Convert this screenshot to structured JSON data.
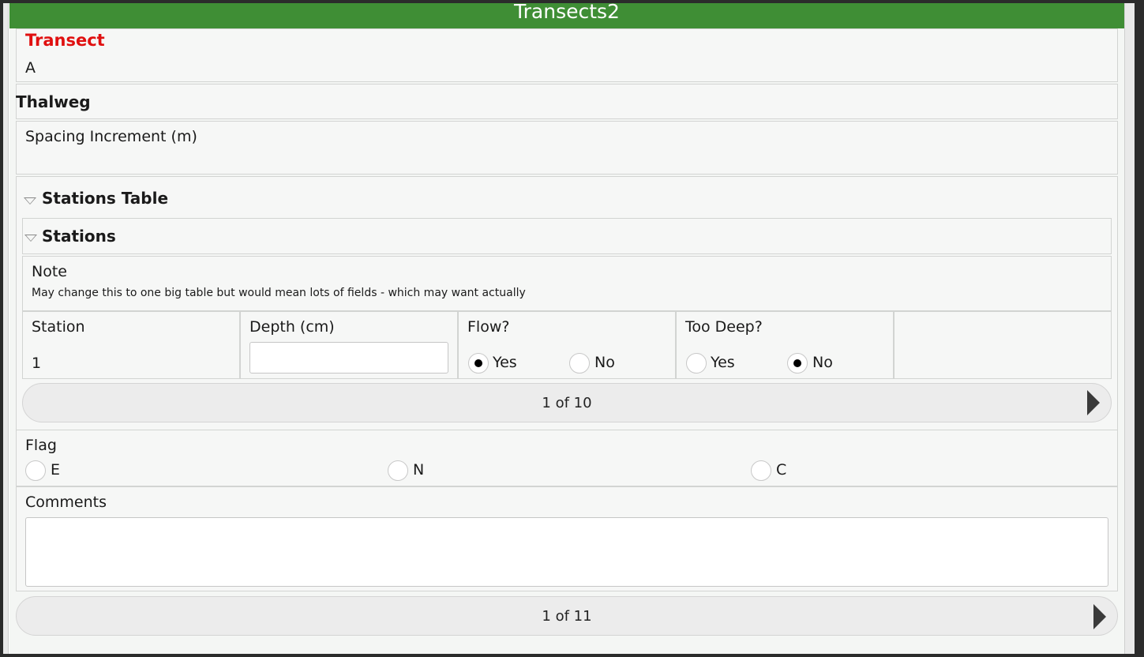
{
  "window": {
    "title": "Transects2"
  },
  "transect": {
    "label": "Transect",
    "value": "A"
  },
  "thalweg": {
    "label": "Thalweg"
  },
  "spacing": {
    "label": "Spacing Increment (m)",
    "value": ""
  },
  "stations_table": {
    "title": "Stations Table"
  },
  "stations": {
    "title": "Stations",
    "note_label": "Note",
    "note_text": "May change this to one big table but would mean lots of fields - which may want actually",
    "columns": {
      "station": "Station",
      "depth": "Depth (cm)",
      "flow": "Flow?",
      "too_deep": "Too Deep?"
    },
    "row": {
      "station": "1",
      "depth": "",
      "flow": {
        "options": [
          "Yes",
          "No"
        ],
        "selected": "Yes"
      },
      "too_deep": {
        "options": [
          "Yes",
          "No"
        ],
        "selected": "No"
      }
    },
    "pager": "1 of 10"
  },
  "flag": {
    "label": "Flag",
    "options": [
      "E",
      "N",
      "C"
    ],
    "selected": ""
  },
  "comments": {
    "label": "Comments",
    "value": ""
  },
  "main_pager": "1 of 11"
}
